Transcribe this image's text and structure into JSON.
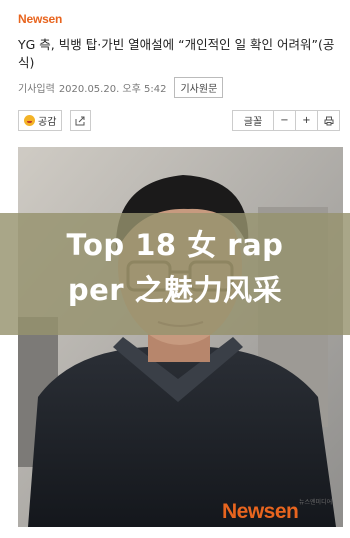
{
  "header": {
    "logo": "Newsen"
  },
  "article": {
    "headline": "YG 측, 빅뱅 탑·가빈 열애설에 “개인적인 일 확인 어려워”(공식)",
    "date_label": "기사입력",
    "date_value": "2020.05.20. 오후 5:42",
    "original_button": "기사원문"
  },
  "toolbar": {
    "like_label": "공감",
    "like_icon": "smiley-emoji-icon",
    "share_icon": "share-arrow-icon",
    "font_label": "글꼴",
    "decrease": "−",
    "increase": "+",
    "print_icon": "print-icon"
  },
  "overlay": {
    "line1": "Top 18 女 rap",
    "line2": "per 之魅力风采"
  },
  "watermark": {
    "brand": "Newsen",
    "small": "뉴스엔미디어"
  },
  "colors": {
    "brand_orange": "#e8651f",
    "overlay": "#96926e"
  }
}
